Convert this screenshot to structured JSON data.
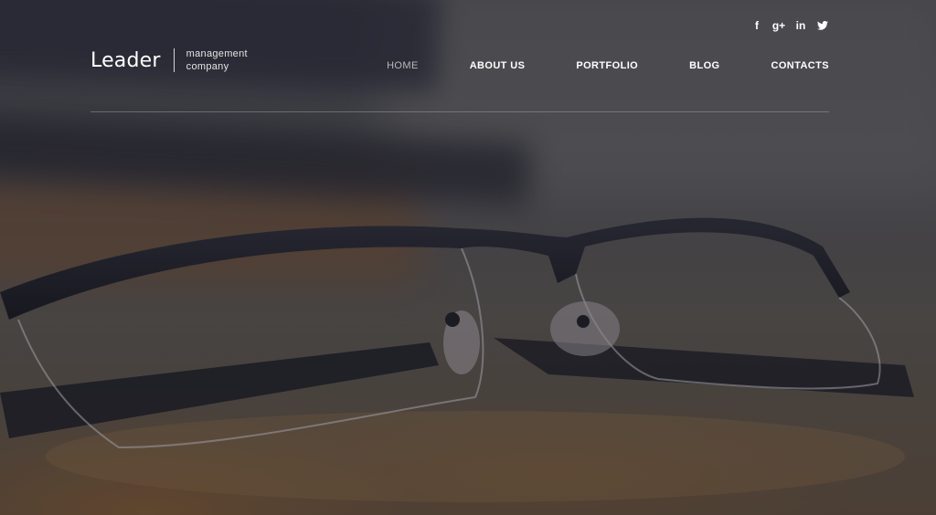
{
  "brand": {
    "name": "Leader",
    "tagline_line1": "management",
    "tagline_line2": "company"
  },
  "social": [
    {
      "icon": "facebook-icon",
      "glyph": "f"
    },
    {
      "icon": "google-plus-icon",
      "glyph": "g+"
    },
    {
      "icon": "linkedin-icon",
      "glyph": "in"
    },
    {
      "icon": "twitter-icon",
      "glyph": "t"
    }
  ],
  "nav": {
    "items": [
      {
        "label": "HOME",
        "active": true
      },
      {
        "label": "ABOUT US",
        "active": false
      },
      {
        "label": "PORTFOLIO",
        "active": false
      },
      {
        "label": "BLOG",
        "active": false
      },
      {
        "label": "CONTACTS",
        "active": false
      }
    ]
  },
  "colors": {
    "text": "#ffffff",
    "nav_active": "#b8b8bb",
    "divider": "#c8c8c8"
  }
}
